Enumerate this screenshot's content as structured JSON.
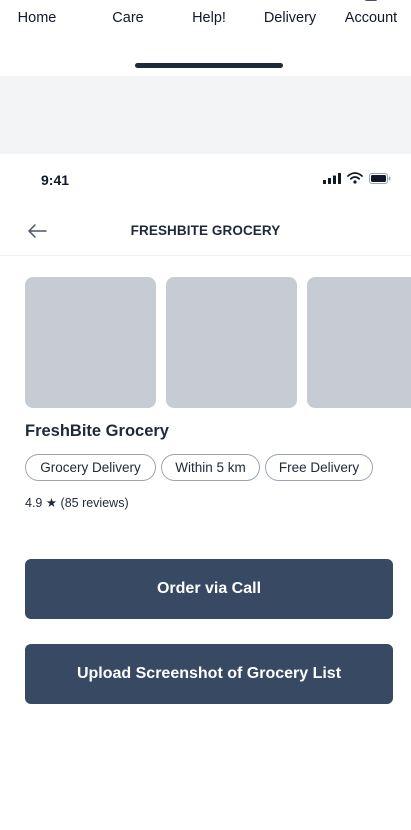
{
  "prev_tabbar": {
    "tabs": [
      {
        "label": "Home",
        "icon": "home-icon"
      },
      {
        "label": "Care",
        "icon": "care-icon"
      },
      {
        "label": "Help!",
        "icon": "help-icon"
      },
      {
        "label": "Delivery",
        "icon": "delivery-icon"
      },
      {
        "label": "Account",
        "icon": "account-icon"
      }
    ]
  },
  "status_bar": {
    "time": "9:41",
    "icons": [
      "signal-icon",
      "wifi-icon",
      "battery-icon"
    ]
  },
  "header": {
    "back_icon": "back-arrow-icon",
    "title": "FRESHBITE GROCERY"
  },
  "store": {
    "name": "FreshBite Grocery",
    "tags": [
      "Grocery Delivery",
      "Within 5 km",
      "Free Delivery"
    ],
    "rating": "4.9 ★ (85 reviews)"
  },
  "actions": {
    "order_call_label": "Order via Call",
    "upload_label": "Upload Screenshot of Grocery List"
  },
  "colors": {
    "primary_button": "#374963",
    "image_placeholder": "#c7ccd4",
    "background_gap": "#f3f4f6",
    "text": "#1f2937"
  }
}
